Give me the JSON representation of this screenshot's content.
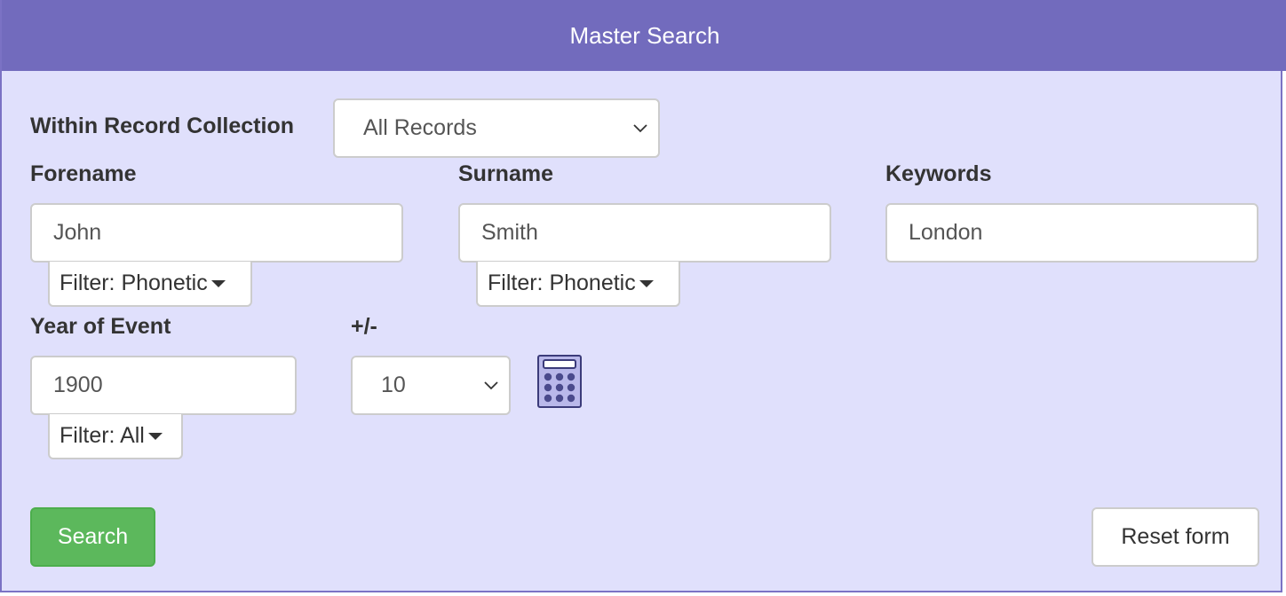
{
  "header": {
    "title": "Master Search"
  },
  "collection": {
    "label": "Within Record Collection",
    "value": "All Records"
  },
  "forename": {
    "label": "Forename",
    "value": "John",
    "filter": "Filter: Phonetic"
  },
  "surname": {
    "label": "Surname",
    "value": "Smith",
    "filter": "Filter: Phonetic"
  },
  "keywords": {
    "label": "Keywords",
    "value": "London"
  },
  "year": {
    "label": "Year of Event",
    "value": "1900",
    "filter": "Filter: All"
  },
  "range": {
    "label": "+/-",
    "value": "10"
  },
  "icons": {
    "calculator": "calculator-icon",
    "select_arrow": "chevron-down-icon",
    "filter_arrow": "caret-down-icon"
  },
  "buttons": {
    "search": "Search",
    "reset": "Reset form"
  },
  "colors": {
    "header": "#726bbd",
    "panel": "#e0e0fc",
    "search_button": "#5cb85c"
  }
}
